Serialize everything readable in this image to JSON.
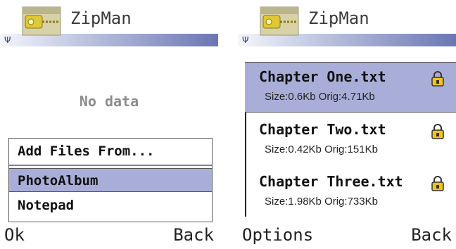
{
  "left_screen": {
    "app_title": "ZipMan",
    "empty_message": "No data",
    "popup": {
      "title": "Add Files From...",
      "items": [
        {
          "label": "PhotoAlbum",
          "selected": true
        },
        {
          "label": "Notepad",
          "selected": false
        }
      ]
    },
    "softkeys": {
      "left": "Ok",
      "right": "Back"
    }
  },
  "right_screen": {
    "app_title": "ZipMan",
    "files": [
      {
        "name": "Chapter One.txt",
        "size": "Size:0.6Kb",
        "orig": "Orig:4.71Kb",
        "selected": true,
        "icon": "lock-icon"
      },
      {
        "name": "Chapter Two.txt",
        "size": "Size:0.42Kb",
        "orig": "Orig:151Kb",
        "selected": false,
        "icon": "lock-icon"
      },
      {
        "name": "Chapter Three.txt",
        "size": "Size:1.98Kb",
        "orig": "Orig:733Kb",
        "selected": false,
        "icon": "lock-icon"
      }
    ],
    "softkeys": {
      "left": "Options",
      "right": "Back"
    }
  },
  "colors": {
    "selection": "#a9aed8",
    "title_bar_end": "#6a76b3",
    "lock_body": "#f2c418"
  }
}
